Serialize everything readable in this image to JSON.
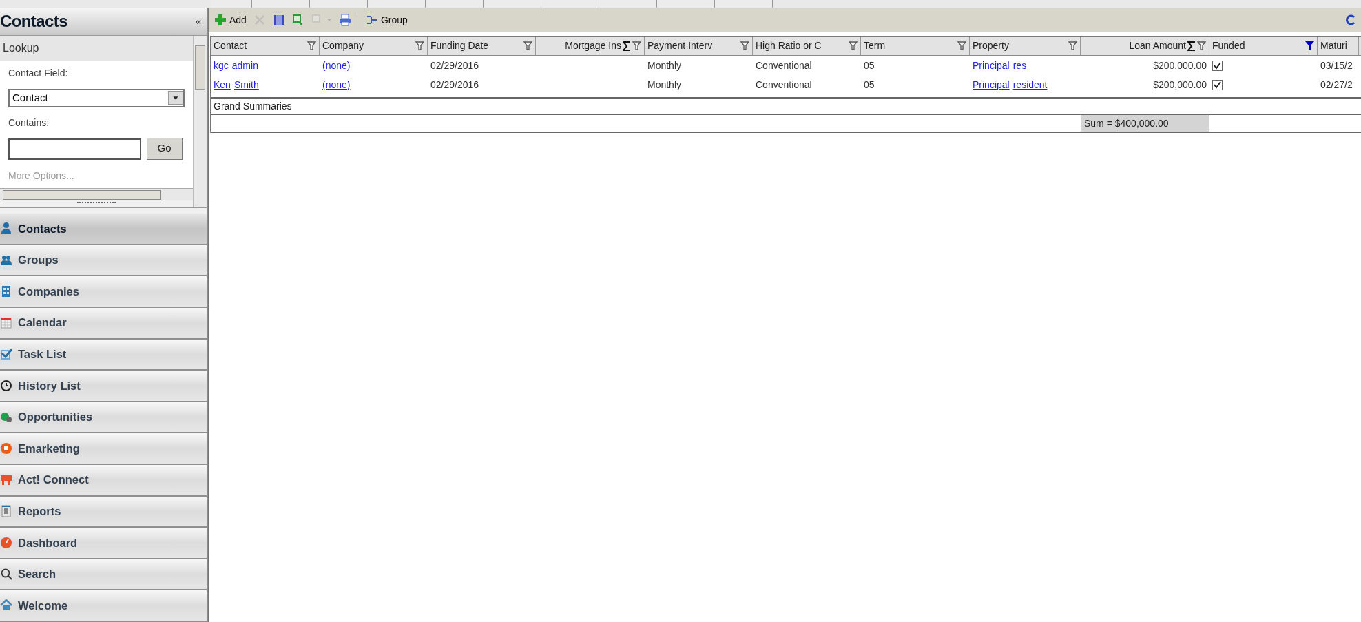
{
  "sidebar": {
    "title": "Contacts",
    "collapse": "«",
    "lookup": {
      "title": "Lookup",
      "field_label": "Contact Field:",
      "field_value": "Contact",
      "contains_label": "Contains:",
      "go": "Go",
      "more": "More Options..."
    },
    "items": [
      {
        "label": "Contacts",
        "kind": "contacts",
        "selected": true
      },
      {
        "label": "Groups",
        "kind": "groups",
        "selected": false
      },
      {
        "label": "Companies",
        "kind": "companies",
        "selected": false
      },
      {
        "label": "Calendar",
        "kind": "calendar",
        "selected": false
      },
      {
        "label": "Task List",
        "kind": "tasks",
        "selected": false
      },
      {
        "label": "History List",
        "kind": "history",
        "selected": false
      },
      {
        "label": "Opportunities",
        "kind": "opportunities",
        "selected": false
      },
      {
        "label": "Emarketing",
        "kind": "emarketing",
        "selected": false
      },
      {
        "label": "Act! Connect",
        "kind": "connect",
        "selected": false
      },
      {
        "label": "Reports",
        "kind": "reports",
        "selected": false
      },
      {
        "label": "Dashboard",
        "kind": "dashboard",
        "selected": false
      },
      {
        "label": "Search",
        "kind": "search",
        "selected": false
      },
      {
        "label": "Welcome",
        "kind": "welcome",
        "selected": false
      }
    ]
  },
  "toolbar": [
    {
      "kind": "add",
      "label": "Add",
      "disabled": false
    },
    {
      "kind": "delete",
      "disabled": true
    },
    {
      "kind": "columns",
      "disabled": false
    },
    {
      "kind": "export",
      "disabled": false
    },
    {
      "kind": "import",
      "disabled": true
    },
    {
      "kind": "print",
      "disabled": false
    },
    {
      "kind": "group",
      "label": "Group",
      "disabled": false
    }
  ],
  "table": {
    "columns": [
      {
        "label": "Contact",
        "summed": false,
        "filter_active": false
      },
      {
        "label": "Company",
        "summed": false,
        "filter_active": false
      },
      {
        "label": "Funding Date",
        "summed": false,
        "filter_active": false
      },
      {
        "label": "Mortgage Ins",
        "summed": true,
        "filter_active": false
      },
      {
        "label": "Payment Interv",
        "summed": false,
        "filter_active": false
      },
      {
        "label": "High Ratio or C",
        "summed": false,
        "filter_active": false
      },
      {
        "label": "Term",
        "summed": false,
        "filter_active": false
      },
      {
        "label": "Property",
        "summed": false,
        "filter_active": false
      },
      {
        "label": "Loan Amount",
        "summed": true,
        "filter_active": false,
        "summary": "Sum = $400,000.00"
      },
      {
        "label": "Funded",
        "summed": false,
        "filter_active": true
      },
      {
        "label": "Maturi"
      }
    ],
    "rows": [
      {
        "cells": [
          {
            "kind": "links",
            "words": [
              "kgc",
              "admin"
            ]
          },
          {
            "kind": "links",
            "words": [
              "(none)"
            ]
          },
          {
            "kind": "text",
            "text": "02/29/2016"
          },
          {
            "kind": "blank"
          },
          {
            "kind": "text",
            "text": "Monthly"
          },
          {
            "kind": "text",
            "text": "Conventional"
          },
          {
            "kind": "text",
            "text": "05"
          },
          {
            "kind": "links",
            "words": [
              "Principal",
              "res"
            ]
          },
          {
            "kind": "text",
            "text": "$200,000.00"
          },
          {
            "kind": "check",
            "checked": true
          },
          {
            "kind": "text",
            "text": "03/15/2"
          }
        ]
      },
      {
        "cells": [
          {
            "kind": "links",
            "words": [
              "Ken",
              "Smith"
            ]
          },
          {
            "kind": "links",
            "words": [
              "(none)"
            ]
          },
          {
            "kind": "text",
            "text": "02/29/2016"
          },
          {
            "kind": "blank"
          },
          {
            "kind": "text",
            "text": "Monthly"
          },
          {
            "kind": "text",
            "text": "Conventional"
          },
          {
            "kind": "text",
            "text": "05"
          },
          {
            "kind": "links",
            "words": [
              "Principal",
              "resident"
            ]
          },
          {
            "kind": "text",
            "text": "$200,000.00"
          },
          {
            "kind": "check",
            "checked": true
          },
          {
            "kind": "text",
            "text": "02/27/2"
          }
        ]
      }
    ],
    "summary_title": "Grand Summaries"
  }
}
